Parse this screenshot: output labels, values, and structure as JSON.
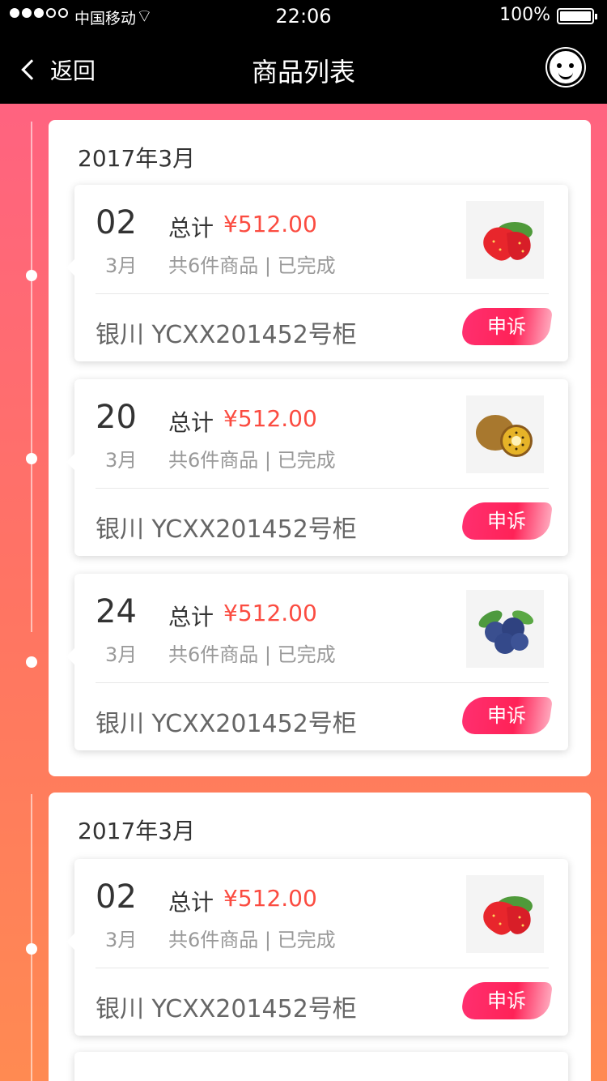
{
  "status_bar": {
    "carrier": "中国移动",
    "time": "22:06",
    "battery": "100%"
  },
  "nav": {
    "back_label": "返回",
    "title": "商品列表"
  },
  "groups": [
    {
      "month_title": "2017年3月",
      "orders": [
        {
          "day": "02",
          "month": "3月",
          "total_label": "总计",
          "price": "¥512.00",
          "summary": "共6件商品 | 已完成",
          "cabinet": "银川 YCXX201452号柜",
          "appeal_label": "申诉",
          "product": "strawberry-image"
        },
        {
          "day": "20",
          "month": "3月",
          "total_label": "总计",
          "price": "¥512.00",
          "summary": "共6件商品 | 已完成",
          "cabinet": "银川 YCXX201452号柜",
          "appeal_label": "申诉",
          "product": "kiwi-image"
        },
        {
          "day": "24",
          "month": "3月",
          "total_label": "总计",
          "price": "¥512.00",
          "summary": "共6件商品 | 已完成",
          "cabinet": "银川 YCXX201452号柜",
          "appeal_label": "申诉",
          "product": "blueberry-image"
        }
      ]
    },
    {
      "month_title": "2017年3月",
      "orders": [
        {
          "day": "02",
          "month": "3月",
          "total_label": "总计",
          "price": "¥512.00",
          "summary": "共6件商品 | 已完成",
          "cabinet": "银川 YCXX201452号柜",
          "appeal_label": "申诉",
          "product": "strawberry-image"
        }
      ]
    }
  ],
  "colors": {
    "price": "#fb4c41",
    "primary_text": "#333333",
    "secondary_text": "#999999",
    "cabinet_text": "#666666",
    "appeal": "#ff2257"
  }
}
